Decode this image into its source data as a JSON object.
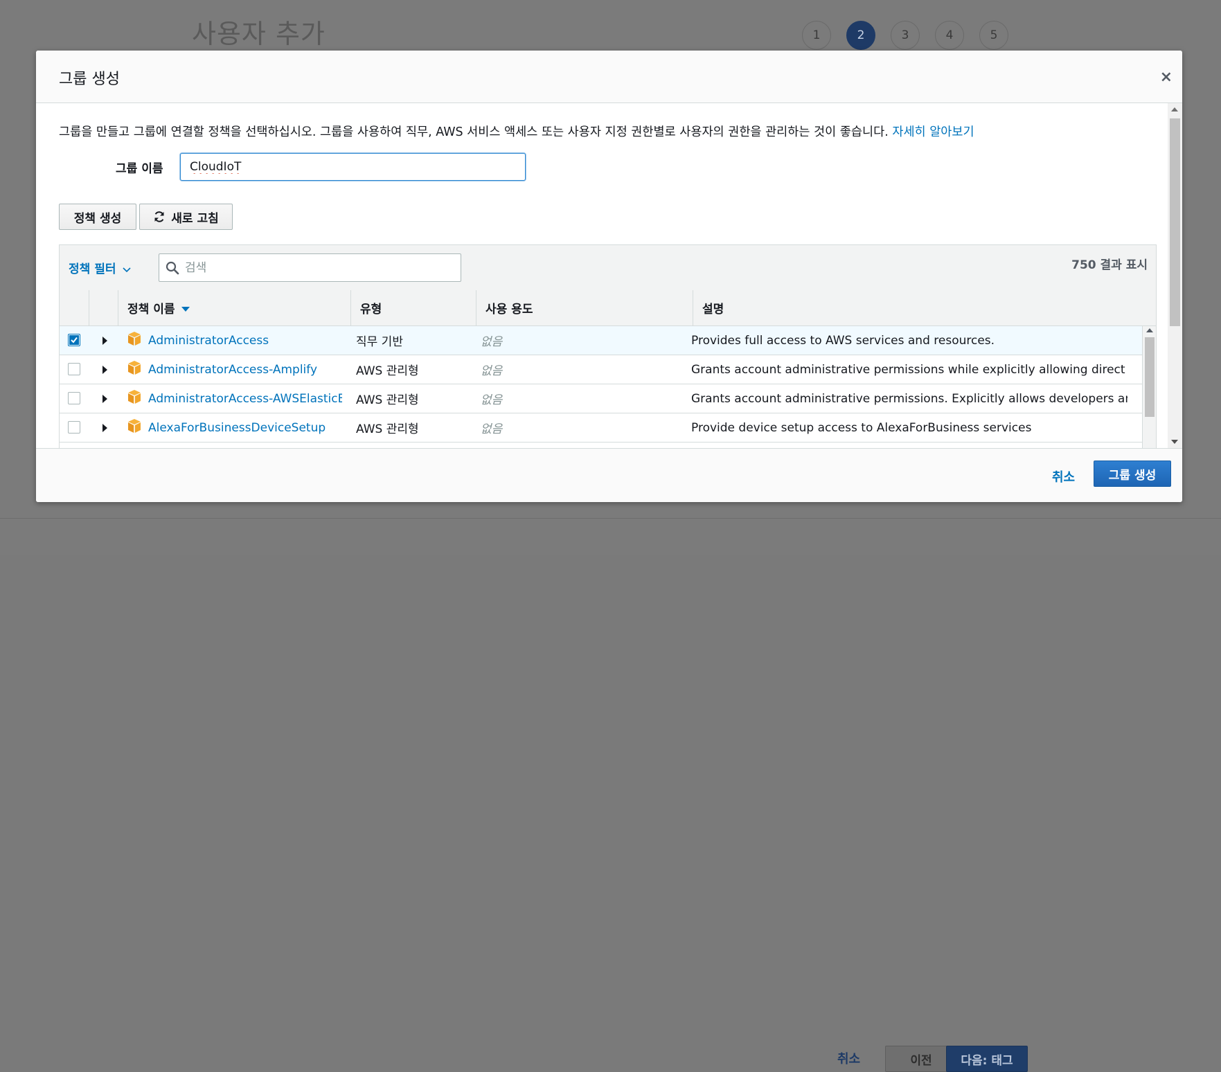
{
  "background": {
    "title": "사용자 추가",
    "steps": [
      "1",
      "2",
      "3",
      "4",
      "5"
    ],
    "active_step": "2",
    "footer": {
      "cancel": "취소",
      "previous": "이전",
      "next": "다음: 태그"
    }
  },
  "modal": {
    "title": "그룹 생성",
    "close_icon": "×",
    "description": "그룹을 만들고 그룹에 연결할 정책을 선택하십시오. 그룹을 사용하여 직무, AWS 서비스 액세스 또는 사용자 지정 권한별로 사용자의 권한을 관리하는 것이 좋습니다.",
    "learn_more": "자세히 알아보기",
    "group_name_label": "그룹 이름",
    "group_name_value": "CloudIoT",
    "buttons": {
      "create_policy": "정책 생성",
      "refresh": "새로 고침"
    },
    "filter_label": "정책 필터",
    "search_placeholder": "검색",
    "result_count": "750 결과 표시",
    "columns": {
      "name": "정책 이름",
      "type": "유형",
      "usage": "사용 용도",
      "description": "설명"
    },
    "rows": [
      {
        "checked": true,
        "name": "AdministratorAccess",
        "type": "직무 기반",
        "usage": "없음",
        "description": "Provides full access to AWS services and resources."
      },
      {
        "checked": false,
        "name": "AdministratorAccess-Amplify",
        "type": "AWS 관리형",
        "usage": "없음",
        "description": "Grants account administrative permissions while explicitly allowing direct acc..."
      },
      {
        "checked": false,
        "name": "AdministratorAccess-AWSElasticB...",
        "type": "AWS 관리형",
        "usage": "없음",
        "description": "Grants account administrative permissions. Explicitly allows developers and a..."
      },
      {
        "checked": false,
        "name": "AlexaForBusinessDeviceSetup",
        "type": "AWS 관리형",
        "usage": "없음",
        "description": "Provide device setup access to AlexaForBusiness services"
      }
    ],
    "footer": {
      "cancel": "취소",
      "create_group": "그룹 생성"
    }
  },
  "colors": {
    "link": "#0073bb",
    "primary_button": "#1e65b4",
    "selected_row": "#f1faff"
  },
  "icons": [
    "close-icon",
    "refresh-icon",
    "chevron-down-icon",
    "search-icon",
    "sort-desc-icon",
    "expand-arrow-icon",
    "policy-package-icon",
    "checkbox-check-icon"
  ]
}
